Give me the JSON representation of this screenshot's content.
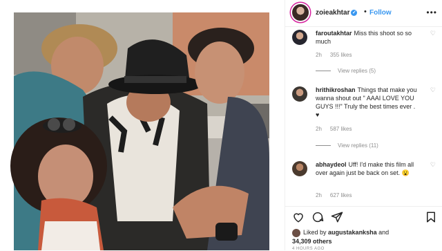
{
  "post": {
    "username": "zoieakhtar",
    "follow_label": "Follow",
    "separator": "•",
    "more_label": "•••"
  },
  "comments": [
    {
      "username": "faroutakhtar",
      "text": "Miss this shoot so so much",
      "time": "2h",
      "likes": "355 likes",
      "replies": "View replies (5)"
    },
    {
      "username": "hrithikroshan",
      "text": "Things that make you wanna shout out \" AAAI LOVE YOU GUYS !!!\" Truly the best times ever . ♥",
      "time": "2h",
      "likes": "587 likes",
      "replies": "View replies (11)"
    },
    {
      "username": "abhaydeol",
      "text": "Uff! I'd make this film all over again just be back on set. 😮",
      "time": "2h",
      "likes": "627 likes"
    }
  ],
  "liked_by": {
    "prefix": "Liked by",
    "user": "augustakanksha",
    "middle": "and",
    "count": "34,309 others"
  },
  "timestamp": "4 HOURS AGO",
  "colors": {
    "accent": "#3897f0",
    "text": "#262626",
    "muted": "#8e8e8e",
    "border": "#efefef"
  },
  "icons": [
    "verified-badge-icon",
    "more-options-icon",
    "heart-icon",
    "comment-icon",
    "share-icon",
    "bookmark-icon"
  ]
}
